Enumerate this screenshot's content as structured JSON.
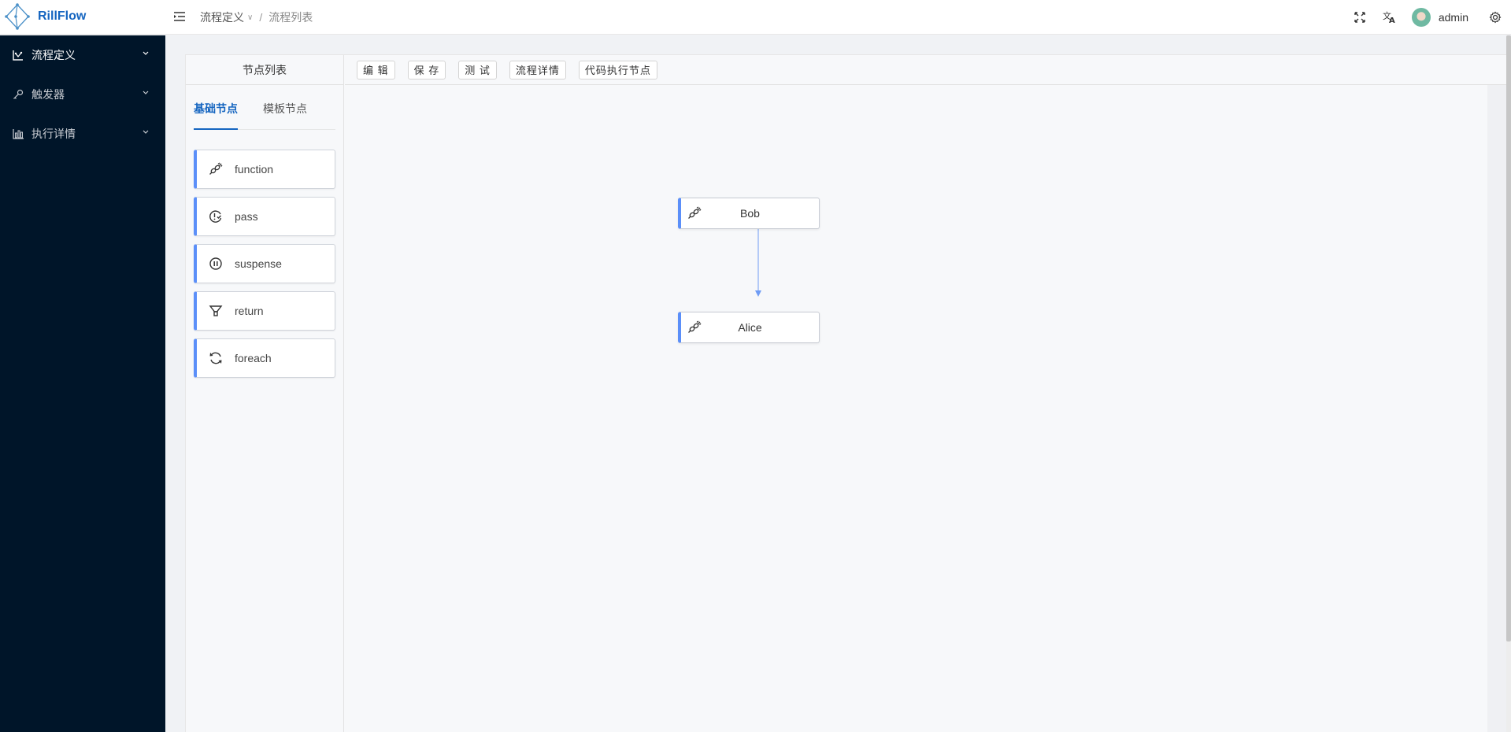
{
  "app": {
    "name": "RillFlow"
  },
  "header": {
    "breadcrumb": [
      "流程定义",
      "流程列表"
    ],
    "breadcrumb_sep": "/",
    "username": "admin",
    "icons": [
      "fullscreen-icon",
      "translate-icon",
      "avatar",
      "settings-icon"
    ]
  },
  "sidebar": {
    "items": [
      {
        "label": "流程定义",
        "icon": "flow-chart-icon",
        "active": true
      },
      {
        "label": "触发器",
        "icon": "key-icon",
        "active": false
      },
      {
        "label": "执行详情",
        "icon": "bar-chart-icon",
        "active": false
      }
    ]
  },
  "node_panel": {
    "title": "节点列表",
    "tabs": [
      {
        "label": "基础节点",
        "active": true
      },
      {
        "label": "模板节点",
        "active": false
      }
    ],
    "nodes": [
      {
        "label": "function",
        "icon": "plug-icon"
      },
      {
        "label": "pass",
        "icon": "pass-clock-icon"
      },
      {
        "label": "suspense",
        "icon": "pause-icon"
      },
      {
        "label": "return",
        "icon": "funnel-icon"
      },
      {
        "label": "foreach",
        "icon": "loop-icon"
      }
    ]
  },
  "toolbar": {
    "buttons": [
      "编 辑",
      "保 存",
      "测 试",
      "流程详情",
      "代码执行节点"
    ]
  },
  "canvas": {
    "nodes": [
      {
        "label": "Bob",
        "icon": "plug-icon"
      },
      {
        "label": "Alice",
        "icon": "plug-icon"
      }
    ],
    "edges": [
      {
        "from": "Bob",
        "to": "Alice"
      }
    ],
    "accent_color": "#5b8ff9"
  }
}
